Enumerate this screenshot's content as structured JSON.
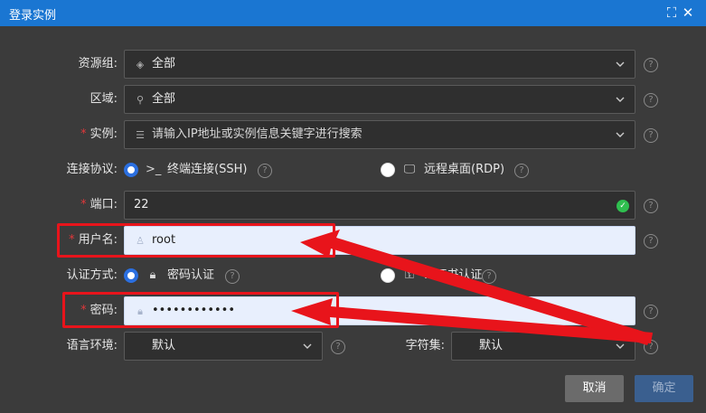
{
  "dialog": {
    "title": "登录实例",
    "maximize_icon": "maximize-icon",
    "close_icon": "close-icon"
  },
  "form": {
    "resource_group": {
      "label": "资源组:",
      "value": "全部",
      "icon": "layers-icon"
    },
    "region": {
      "label": "区域:",
      "value": "全部",
      "icon": "location-icon"
    },
    "instance": {
      "required_mark": "*",
      "label": "实例:",
      "placeholder": "请输入IP地址或实例信息关键字进行搜索",
      "icon": "server-list-icon"
    },
    "protocol": {
      "label": "连接协议:",
      "options": [
        {
          "label": "终端连接(SSH)",
          "selected": true,
          "icon": "terminal-icon"
        },
        {
          "label": "远程桌面(RDP)",
          "selected": false,
          "icon": "monitor-icon"
        }
      ]
    },
    "port": {
      "required_mark": "*",
      "label": "端口:",
      "value": "22"
    },
    "username": {
      "required_mark": "*",
      "label": "用户名:",
      "value": "root",
      "icon": "user-icon"
    },
    "auth": {
      "label": "认证方式:",
      "options": [
        {
          "label": "密码认证",
          "selected": true,
          "icon": "lock-icon"
        },
        {
          "label": "...证书认证",
          "selected": false,
          "icon": "key-icon"
        }
      ]
    },
    "password": {
      "required_mark": "*",
      "label": "密码:",
      "value": "••••••••••••",
      "icon": "lock-icon"
    },
    "language": {
      "label": "语言环境:",
      "value": "默认"
    },
    "charset": {
      "label": "字符集:",
      "value": "默认"
    }
  },
  "footer": {
    "cancel_label": "取消",
    "ok_label": "确定"
  },
  "colors": {
    "titlebar": "#1a76d2",
    "background": "#3b3b3b",
    "required": "#e0383b",
    "radio_selected": "#2b6fe0",
    "annotation_red": "#e8141b",
    "success": "#2fbf4f"
  }
}
